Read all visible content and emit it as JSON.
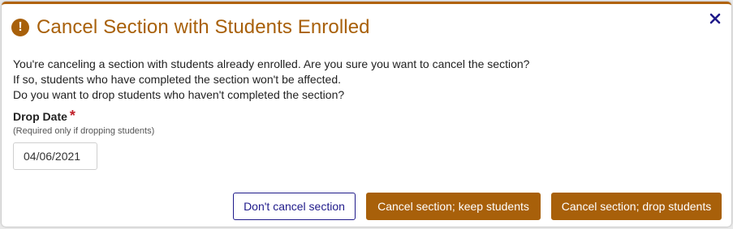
{
  "dialog": {
    "title": "Cancel Section with Students Enrolled",
    "warning_icon_glyph": "!",
    "icons": {
      "header": "exclamation-circle-icon",
      "close": "close-x-icon"
    },
    "colors": {
      "accent": "#a8600a",
      "outline_button": "#1f1a8a",
      "required": "#c0202a"
    },
    "message_lines": [
      "You're canceling a section with students already enrolled. Are you sure you want to cancel the section?",
      "If so, students who have completed the section won't be affected.",
      "Do you want to drop students who haven't completed the section?"
    ],
    "drop_date": {
      "label": "Drop Date",
      "required_marker": "*",
      "hint": "(Required only if dropping students)",
      "value": "04/06/2021"
    },
    "buttons": {
      "dont_cancel": "Don't cancel section",
      "cancel_keep": "Cancel section; keep students",
      "cancel_drop": "Cancel section; drop students"
    }
  }
}
